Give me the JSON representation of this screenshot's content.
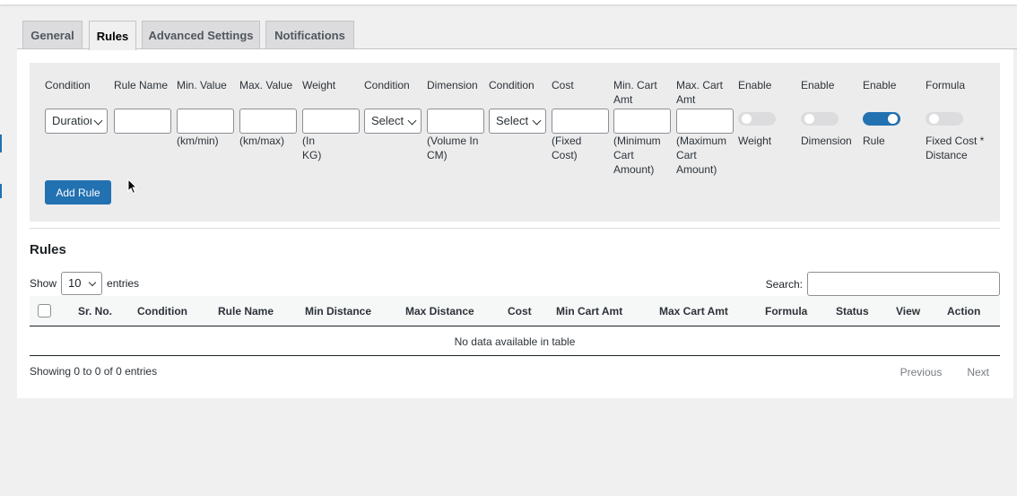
{
  "tabs": [
    {
      "label": "General"
    },
    {
      "label": "Rules"
    },
    {
      "label": "Advanced Settings"
    },
    {
      "label": "Notifications"
    }
  ],
  "form": {
    "columns": [
      {
        "label": "Condition",
        "hint": "",
        "value": "Duration"
      },
      {
        "label": "Rule Name",
        "hint": ""
      },
      {
        "label": "Min. Value",
        "hint": "(km/min)"
      },
      {
        "label": "Max. Value",
        "hint": "(km/max)"
      },
      {
        "label": "Weight",
        "hint": "(In KG)"
      },
      {
        "label": "Condition",
        "hint": "",
        "value": "Select"
      },
      {
        "label": "Dimension",
        "hint": "(Volume In CM)"
      },
      {
        "label": "Condition",
        "hint": "",
        "value": "Select"
      },
      {
        "label": "Cost",
        "hint": "(Fixed Cost)"
      },
      {
        "label": "Min. Cart Amt",
        "hint": "(Minimum Cart Amount)"
      },
      {
        "label": "Max. Cart Amt",
        "hint": "(Maximum Cart Amount)"
      },
      {
        "label": "Enable",
        "hint": "Weight",
        "on": false
      },
      {
        "label": "Enable",
        "hint": "Dimension",
        "on": false
      },
      {
        "label": "Enable",
        "hint": "Rule",
        "on": true
      },
      {
        "label": "Formula",
        "hint": "Fixed Cost * Distance",
        "on": false
      }
    ],
    "add_button": "Add Rule"
  },
  "rules": {
    "title": "Rules",
    "show_label": "Show",
    "page_length": "10",
    "entries_label": "entries",
    "search_label": "Search:",
    "search_value": "",
    "columns": [
      "Sr. No.",
      "Condition",
      "Rule Name",
      "Min Distance",
      "Max Distance",
      "Cost",
      "Min Cart Amt",
      "Max Cart Amt",
      "Formula",
      "Status",
      "View",
      "Action"
    ],
    "empty_message": "No data available in table",
    "info": "Showing 0 to 0 of 0 entries",
    "prev": "Previous",
    "next": "Next"
  },
  "colors": {
    "accent": "#2271b1",
    "background": "#f0f0f1",
    "panel": "#ffffff"
  }
}
